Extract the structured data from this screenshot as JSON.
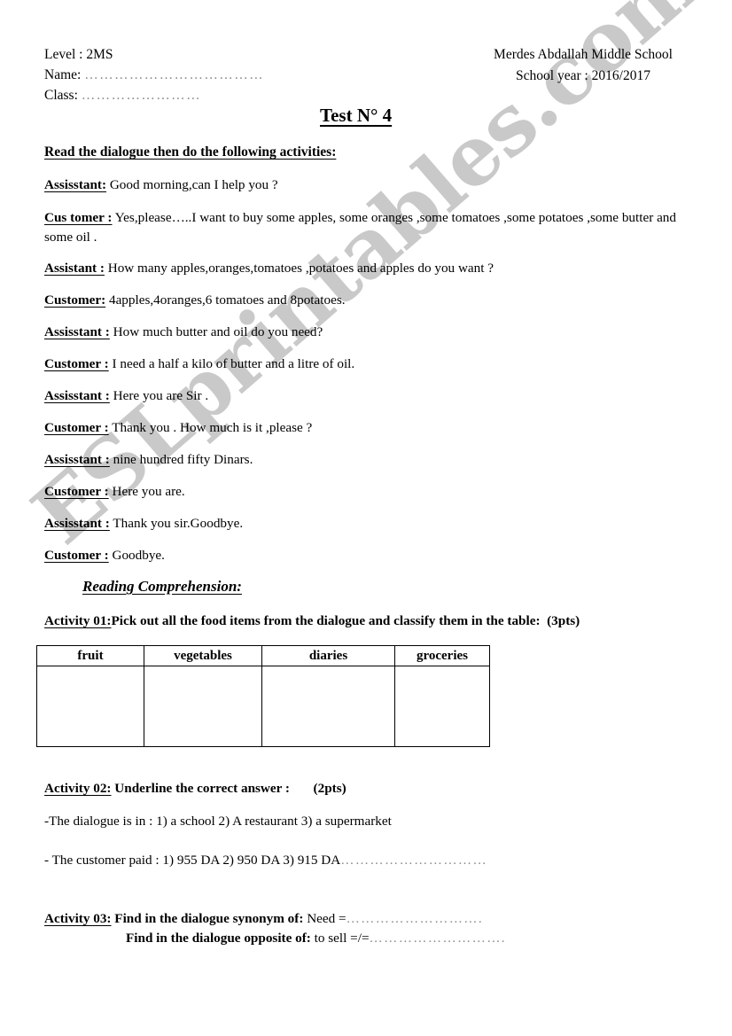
{
  "header": {
    "level_label": "Level : 2MS",
    "name_label": "Name:",
    "name_dots": "………………………………",
    "class_label": "Class:",
    "class_dots": "……………………",
    "school_name": "Merdes Abdallah Middle School",
    "school_year": "School year : 2016/2017"
  },
  "title": "Test N° 4",
  "instruction": "Read the dialogue then do the following activities:",
  "dialogue": [
    {
      "speaker": "Assisstant:",
      "text": " Good morning,can I help you ?"
    },
    {
      "speaker": "Cus tomer :",
      "text": " Yes,please…..I want to buy some apples, some oranges ,some tomatoes ,some potatoes ,some butter and some oil ."
    },
    {
      "speaker": "Assistant :",
      "text": " How many apples,oranges,tomatoes ,potatoes and apples do you want ?"
    },
    {
      "speaker": "Customer:",
      "text": " 4apples,4oranges,6 tomatoes and 8potatoes."
    },
    {
      "speaker": "Assisstant :",
      "text": "  How much butter and oil do you need?"
    },
    {
      "speaker": "Customer :",
      "text": " I need a half a kilo of butter and a litre of oil."
    },
    {
      "speaker": "Assisstant :",
      "text": " Here you are Sir ."
    },
    {
      "speaker": "Customer :",
      "text": " Thank you . How much is it ,please ?"
    },
    {
      "speaker": "Assisstant :",
      "text": " nine hundred fifty  Dinars."
    },
    {
      "speaker": "Customer :",
      "text": " Here you are."
    },
    {
      "speaker": "Assisstant :",
      "text": " Thank you sir.Goodbye."
    },
    {
      "speaker": "Customer :",
      "text": " Goodbye."
    }
  ],
  "section": {
    "reading_comprehension": "Reading Comprehension:"
  },
  "activity01": {
    "label": "Activity 01:",
    "text": "Pick out all the food items from the dialogue and classify them in the table:",
    "points": "(3pts)",
    "table": {
      "headers": [
        "fruit",
        "vegetables",
        "diaries",
        "groceries"
      ],
      "rows": [
        [
          "",
          "",
          "",
          ""
        ]
      ]
    }
  },
  "activity02": {
    "label": "Activity 02:",
    "text": "Underline  the correct answer :",
    "points": "(2pts)",
    "question1": "-The dialogue is in   :  1) a school   2)  A restaurant 3)   a supermarket",
    "question2": "- The customer paid : 1) 955 DA      2)  950 DA      3) 915 DA",
    "question2_dots": "…………………………"
  },
  "activity03": {
    "label": "Activity 03:",
    "line1_bold": " Find in the dialogue synonym of:",
    "line1_value": "  Need =",
    "line1_dots": "……………………….",
    "line2_bold": "Find in the dialogue opposite of:",
    "line2_value": " to sell  =/=",
    "line2_dots": "………………………."
  },
  "watermark": {
    "text": "ESLprintables.com",
    "color": "#c9c9c9"
  }
}
